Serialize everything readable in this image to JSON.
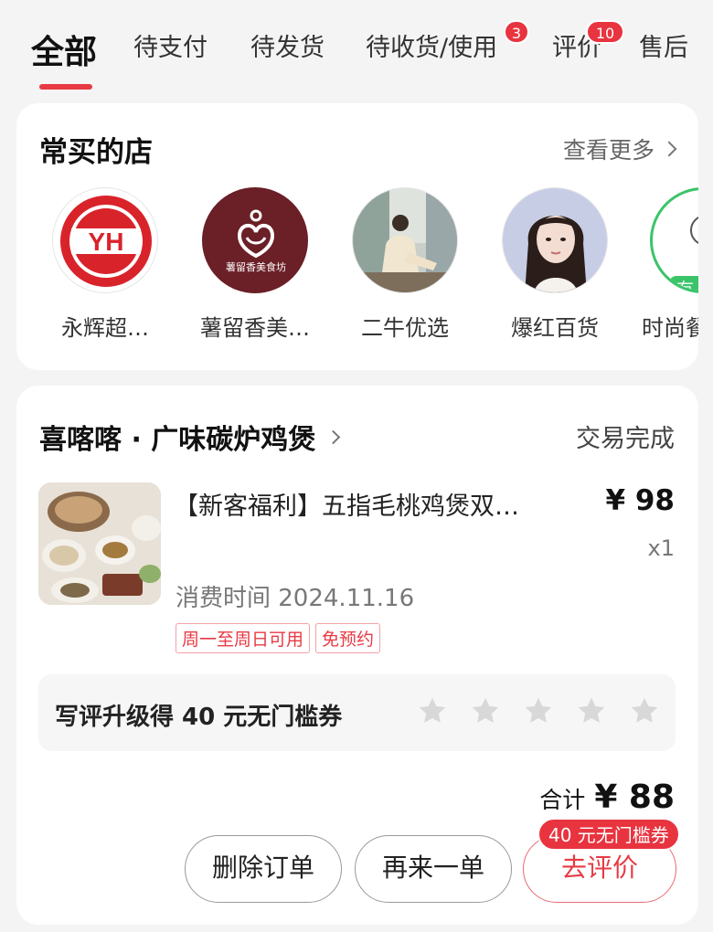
{
  "tabs": [
    {
      "label": "全部",
      "active": true
    },
    {
      "label": "待支付"
    },
    {
      "label": "待发货"
    },
    {
      "label": "待收货/使用",
      "badge": "3"
    },
    {
      "label": "评价",
      "badge": "10"
    },
    {
      "label": "售后"
    }
  ],
  "frequent_stores": {
    "title": "常买的店",
    "more_label": "查看更多",
    "stores": [
      {
        "name": "永辉超…",
        "logo_text": "YH"
      },
      {
        "name": "薯留香美…",
        "logo_text": "薯留香美食坊"
      },
      {
        "name": "二牛优选"
      },
      {
        "name": "爆红百货"
      },
      {
        "name": "时尚餐",
        "badge": "有",
        "logo_text": "YA"
      }
    ]
  },
  "order": {
    "shop_name": "喜喀喀 · 广味碳炉鸡煲",
    "status": "交易完成",
    "product_title": "【新客福利】五指毛桃鸡煲双…",
    "price": "¥ 98",
    "quantity": "x1",
    "consume_time": "消费时间 2024.11.16",
    "tags": [
      "周一至周日可用",
      "免预约"
    ],
    "review_prompt": "写评升级得 40 元无门槛券",
    "total_label": "合计",
    "total_value": "¥ 88",
    "buttons": {
      "delete": "删除订单",
      "again": "再来一单",
      "review": "去评价"
    },
    "coupon_bubble": "40 元无门槛券"
  },
  "colors": {
    "accent": "#e83a44",
    "background": "#f4f4f4",
    "card": "#ffffff"
  }
}
